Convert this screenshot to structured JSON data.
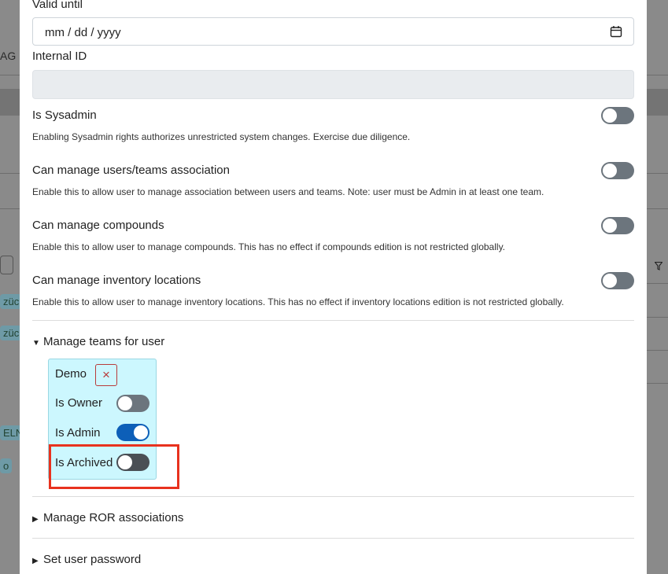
{
  "background": {
    "left_text": "AG N",
    "pill_labels": [
      "züc",
      "züc",
      "ELN",
      "o"
    ]
  },
  "form": {
    "valid_until": {
      "label": "Valid until",
      "placeholder": "mm / dd / yyyy"
    },
    "internal_id": {
      "label": "Internal ID",
      "value": ""
    },
    "permissions": [
      {
        "label": "Is Sysadmin",
        "help": "Enabling Sysadmin rights authorizes unrestricted system changes. Exercise due diligence.",
        "enabled": false
      },
      {
        "label": "Can manage users/teams association",
        "help": "Enable this to allow user to manage association between users and teams. Note: user must be Admin in at least one team.",
        "enabled": false
      },
      {
        "label": "Can manage compounds",
        "help": "Enable this to allow user to manage compounds. This has no effect if compounds edition is not restricted globally.",
        "enabled": false
      },
      {
        "label": "Can manage inventory locations",
        "help": "Enable this to allow user to manage inventory locations. This has no effect if inventory locations edition is not restricted globally.",
        "enabled": false
      }
    ],
    "manage_teams": {
      "caret": "▼",
      "label": "Manage teams for user",
      "team": {
        "name": "Demo",
        "remove_glyph": "×",
        "is_owner": {
          "label": "Is Owner",
          "enabled": false
        },
        "is_admin": {
          "label": "Is Admin",
          "enabled": true
        },
        "is_archived": {
          "label": "Is Archived",
          "enabled": false
        }
      }
    },
    "ror": {
      "caret": "▶",
      "label": "Manage ROR associations"
    },
    "password": {
      "caret": "▶",
      "label": "Set user password"
    }
  },
  "colors": {
    "toggle_on": "#0d5fb8",
    "toggle_off": "#6c757d",
    "team_card_bg": "#ccf7fe",
    "highlight": "#e8321e"
  }
}
